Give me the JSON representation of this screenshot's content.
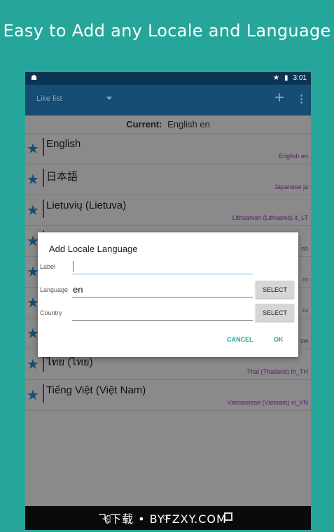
{
  "headline": "Easy to Add any Locale and Language",
  "status_bar": {
    "time": "3:01"
  },
  "app_bar": {
    "spinner_label": "Like list",
    "add_icon": "plus-icon",
    "menu_icon": "more-vert-icon"
  },
  "current": {
    "label": "Current:",
    "value": "English en"
  },
  "locales": [
    {
      "name": "English",
      "code": "English en"
    },
    {
      "name": "日本語",
      "code": "Japanese ja"
    },
    {
      "name": "Lietuvių (Lietuva)",
      "code": "Lithuanian (Lithuania) lt_LT"
    },
    {
      "name": "",
      "code": "nb"
    },
    {
      "name": "",
      "code": "ro"
    },
    {
      "name": "",
      "code": "ru"
    },
    {
      "name": "",
      "code": "sw"
    },
    {
      "name": "ไทย (ไทย)",
      "code": "Thai (Thailand) th_TH"
    },
    {
      "name": "Tiếng Việt (Việt Nam)",
      "code": "Vietnamese (Vietnam) vi_VN"
    }
  ],
  "dialog": {
    "title": "Add Locale Language",
    "label_field": {
      "label": "Label",
      "value": ""
    },
    "language_field": {
      "label": "Language",
      "value": "en",
      "button": "SELECT"
    },
    "country_field": {
      "label": "Country",
      "value": "",
      "button": "SELECT"
    },
    "cancel": "CANCEL",
    "ok": "OK"
  },
  "watermark": "飞下载 • BYFZXY.COM",
  "colors": {
    "background": "#26a69a",
    "app_bar": "#154d74",
    "status_bar": "#0b3452",
    "accent": "#26a69a"
  }
}
